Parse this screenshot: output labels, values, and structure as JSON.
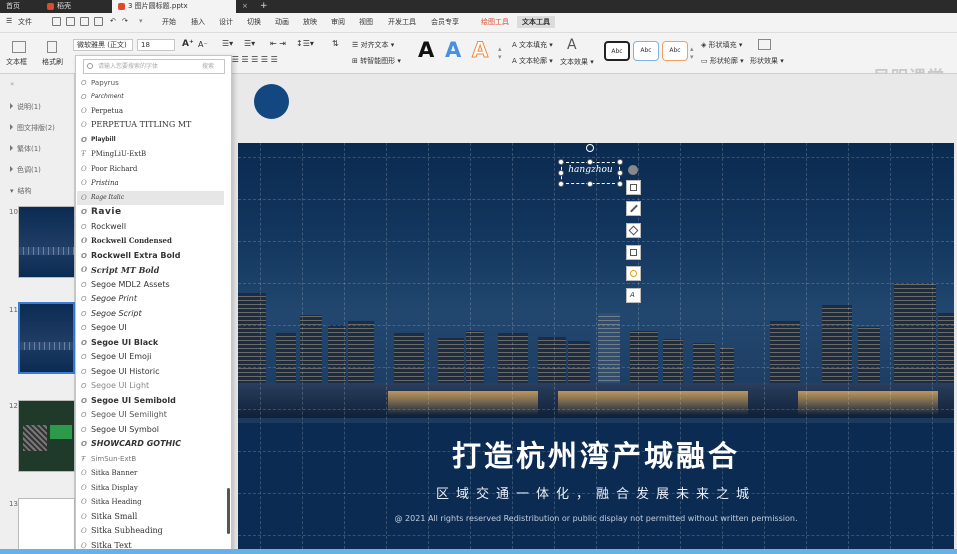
{
  "titlebar": {
    "tabs": [
      "首页",
      "稻壳",
      "3 图片圆标题.pptx"
    ]
  },
  "menubar": {
    "file_label": "文件",
    "items": [
      "开始",
      "插入",
      "设计",
      "切换",
      "动画",
      "放映",
      "审阅",
      "视图",
      "开发工具",
      "会员专享"
    ],
    "context_tabs": [
      "绘图工具",
      "文本工具"
    ]
  },
  "ribbon": {
    "textbox_label": "文本框",
    "format_painter_label": "格式刷",
    "font_name": "微软雅黑 (正文)",
    "font_size": "18",
    "align_text_label": "对齐文本",
    "smartart_label": "转智能图形",
    "text_fill_label": "文本填充",
    "text_outline_label": "文本轮廓",
    "text_effect_label": "文本效果",
    "shape_fill_label": "形状填充",
    "shape_outline_label": "形状轮廓",
    "shape_effect_label": "形状效果",
    "art_letter": "A",
    "style_swatch_label": "Abc",
    "watermark": "吴明课堂"
  },
  "left_pane": {
    "sections": [
      "说明(1)",
      "图文排版(2)",
      "繁体(1)",
      "色调(1)",
      "结构"
    ],
    "slide_numbers": [
      "10",
      "11",
      "12",
      "13"
    ]
  },
  "font_dropdown": {
    "search_placeholder": "请输入您要搜索的字体",
    "search_hint": "搜索",
    "fonts": [
      "Papyrus",
      "Parchment",
      "Perpetua",
      "PERPETUA TITLING MT",
      "Playbill",
      "PMingLiU-ExtB",
      "Poor Richard",
      "Pristina",
      "Rage Italic",
      "Ravie",
      "Rockwell",
      "Rockwell Condensed",
      "Rockwell Extra Bold",
      "Script MT Bold",
      "Segoe MDL2 Assets",
      "Segoe Print",
      "Segoe Script",
      "Segoe UI",
      "Segoe UI Black",
      "Segoe UI Emoji",
      "Segoe UI Historic",
      "Segoe UI Light",
      "Segoe UI Semibold",
      "Segoe UI Semilight",
      "Segoe UI Symbol",
      "SHOWCARD GOTHIC",
      "SimSun-ExtB",
      "Sitka Banner",
      "Sitka Display",
      "Sitka Heading",
      "Sitka Small",
      "Sitka Subheading",
      "Sitka Text"
    ],
    "hovered_font": "Rage Italic"
  },
  "slide": {
    "selected_text": "hangzhou",
    "title": "打造杭州湾产城融合",
    "subtitle": "区域交通一体化，融合发展未来之城",
    "copyright": "@ 2021 All rights reserved Redistribution or public display not permitted without written permission."
  },
  "colors": {
    "accent_red": "#e0492b",
    "slide_navy": "#0c2b52",
    "circle_blue": "#12487f",
    "art_blue": "#4a90e2",
    "art_orange": "#f0883a"
  }
}
